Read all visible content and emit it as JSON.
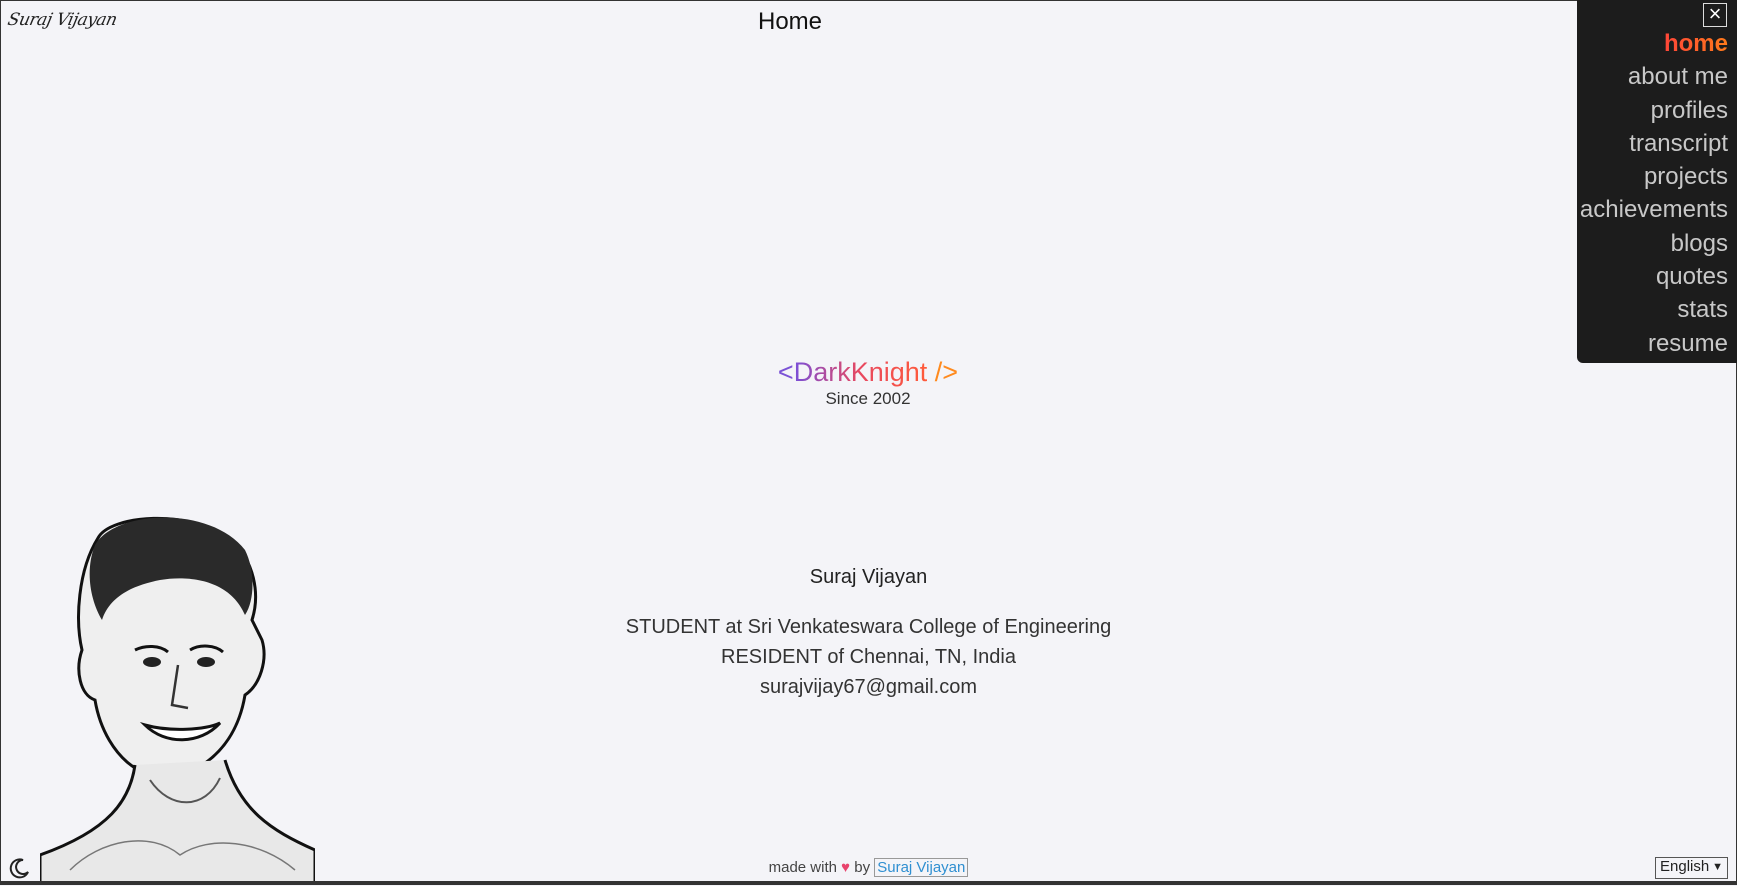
{
  "header": {
    "logo_text": "Suraj Vijayan",
    "page_title": "Home"
  },
  "menu": {
    "close_icon": "close-icon",
    "items": [
      {
        "label": "home",
        "active": true
      },
      {
        "label": "about me"
      },
      {
        "label": "profiles"
      },
      {
        "label": "transcript"
      },
      {
        "label": "projects"
      },
      {
        "label": "achievements"
      },
      {
        "label": "blogs"
      },
      {
        "label": "quotes"
      },
      {
        "label": "stats"
      },
      {
        "label": "resume"
      }
    ]
  },
  "brand": {
    "open_tag": "<",
    "name": "DarkKnight",
    "close_tag": " />",
    "since": "Since 2002"
  },
  "profile": {
    "name": "Suraj Vijayan",
    "line1": "STUDENT at Sri Venkateswara College of Engineering",
    "line2": "RESIDENT of Chennai, TN, India",
    "email": "surajvijay67@gmail.com"
  },
  "footer": {
    "made_with": "made with",
    "by": "by",
    "author": "Suraj Vijayan"
  },
  "language": {
    "selected": "English"
  },
  "colors": {
    "menu_bg": "#1c1c1c",
    "page_bg": "#f4f4f8",
    "accent_link": "#2f8fd1",
    "heart": "#e8436d"
  }
}
